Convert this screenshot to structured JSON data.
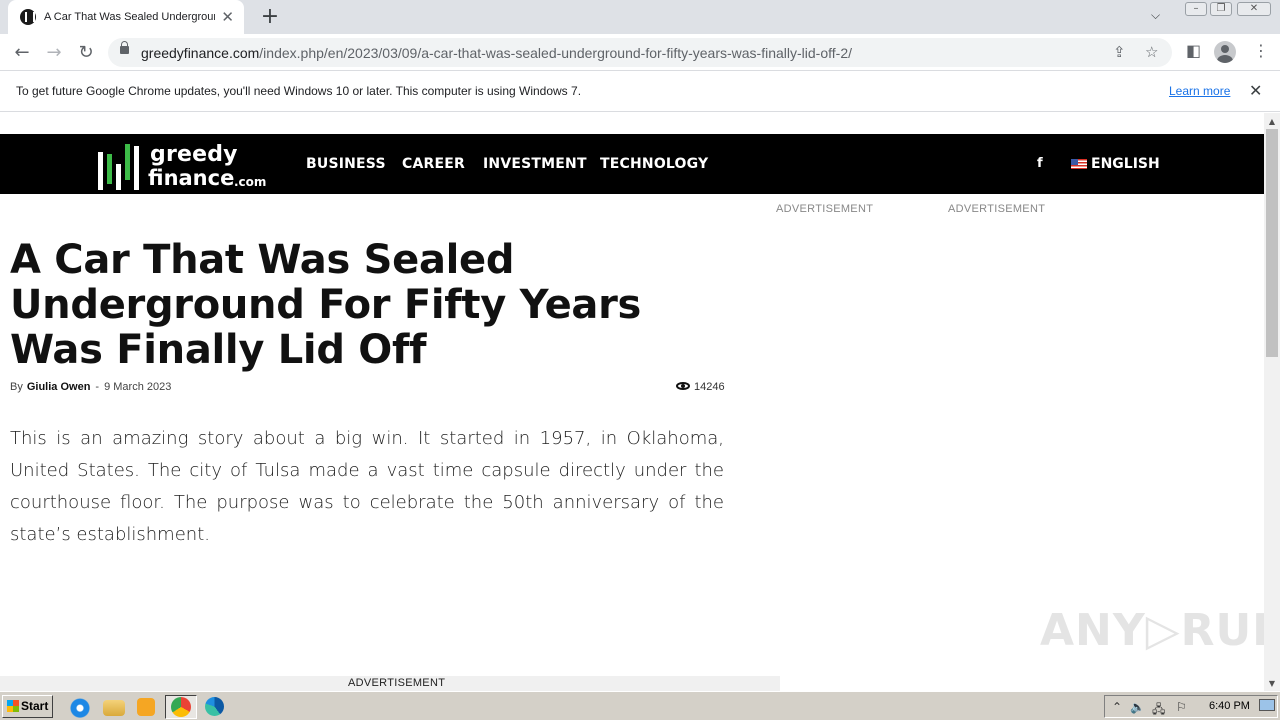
{
  "browser": {
    "tab_title": "A Car That Was Sealed Underground For Fifty Years Was Finally Lid Off",
    "tab_close": "✕",
    "new_tab": "+",
    "url_host": "greedyfinance.com",
    "url_path": "/index.php/en/2023/03/09/a-car-that-was-sealed-underground-for-fifty-years-was-finally-lid-off-2/",
    "infobar_text": "To get future Google Chrome updates, you'll need Windows 10 or later. This computer is using Windows 7.",
    "infobar_link": "Learn more"
  },
  "site": {
    "logo_word1": "greedy",
    "logo_word2": "finance",
    "logo_word3": ".com",
    "menu": [
      "BUSINESS",
      "CAREER",
      "INVESTMENT",
      "TECHNOLOGY"
    ],
    "facebook_icon": "f",
    "language": "ENGLISH",
    "ad_label": "ADVERTISEMENT"
  },
  "article": {
    "title": "A Car That Was Sealed Underground For Fifty Years Was Finally Lid Off",
    "by": "By",
    "author": "Giulia Owen",
    "separator": "-",
    "date": "9 March 2023",
    "views": "14246",
    "body": "This is an amazing story about a big win. It started in 1957, in Oklahoma, United States. The city of Tulsa made a vast time capsule directly under the courthouse floor. The purpose was to celebrate the 50th anniversary of the state’s establishment."
  },
  "watermark": "ANY▷RUN",
  "taskbar": {
    "start_label": "Start",
    "clock": "6:40 PM"
  },
  "colors": {
    "brand_green": "#3dbb48",
    "nav_bg": "#000000",
    "link_blue": "#1a73e8"
  }
}
